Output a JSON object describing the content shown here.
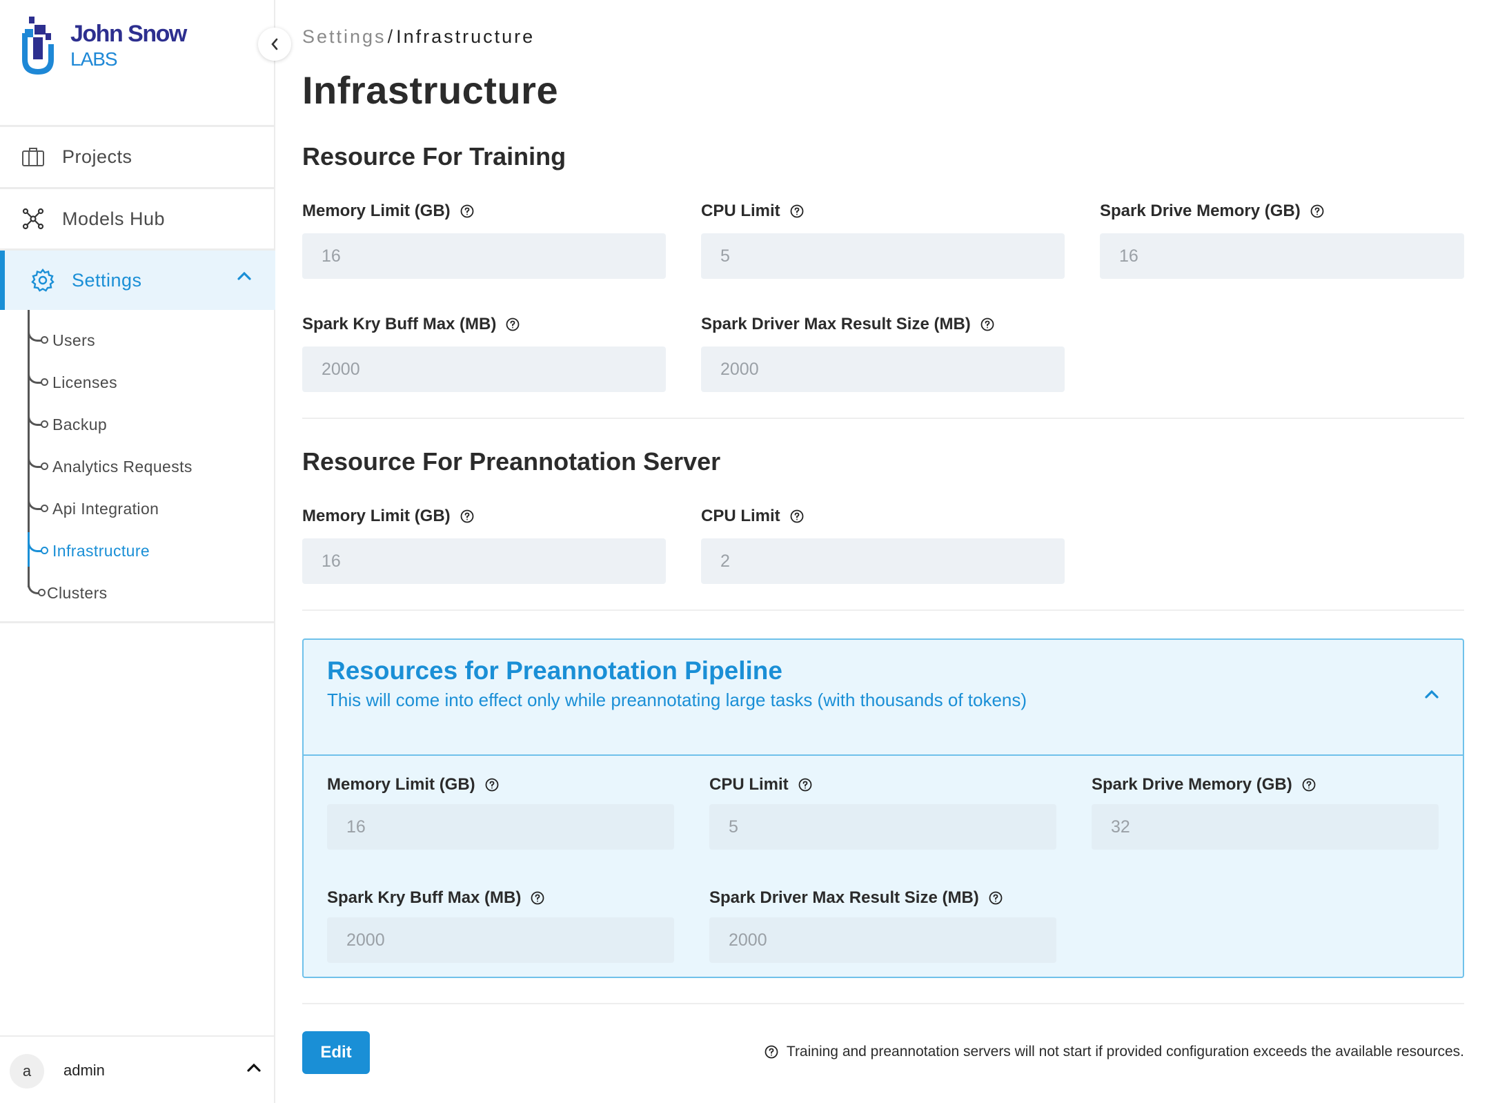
{
  "brand": {
    "line1": "John Snow",
    "line2": "LABS",
    "primary_color": "#2d2f8f",
    "accent_color": "#1a8fd6"
  },
  "sidebar": {
    "items": [
      {
        "label": "Projects",
        "icon": "briefcase-icon"
      },
      {
        "label": "Models Hub",
        "icon": "network-icon"
      },
      {
        "label": "Settings",
        "icon": "gear-icon"
      }
    ],
    "settings_children": [
      "Users",
      "Licenses",
      "Backup",
      "Analytics Requests",
      "Api Integration",
      "Infrastructure",
      "Clusters"
    ],
    "active_child": "Infrastructure"
  },
  "user": {
    "avatar_letter": "a",
    "name": "admin"
  },
  "breadcrumb": {
    "parent": "Settings",
    "separator": "/",
    "current": "Infrastructure"
  },
  "page_title": "Infrastructure",
  "training": {
    "title": "Resource For Training",
    "memory_label": "Memory Limit (GB)",
    "memory_value": "16",
    "cpu_label": "CPU Limit",
    "cpu_value": "5",
    "spark_mem_label": "Spark Drive Memory (GB)",
    "spark_mem_value": "16",
    "kry_label": "Spark Kry Buff Max (MB)",
    "kry_value": "2000",
    "driver_label": "Spark Driver Max Result Size (MB)",
    "driver_value": "2000"
  },
  "preannotation_server": {
    "title": "Resource For Preannotation Server",
    "memory_label": "Memory Limit (GB)",
    "memory_value": "16",
    "cpu_label": "CPU Limit",
    "cpu_value": "2"
  },
  "pipeline": {
    "title": "Resources for Preannotation Pipeline",
    "subtitle": "This will come into effect only while preannotating large tasks (with thousands of tokens)",
    "memory_label": "Memory Limit (GB)",
    "memory_value": "16",
    "cpu_label": "CPU Limit",
    "cpu_value": "5",
    "spark_mem_label": "Spark Drive Memory (GB)",
    "spark_mem_value": "32",
    "kry_label": "Spark Kry Buff Max (MB)",
    "kry_value": "2000",
    "driver_label": "Spark Driver Max Result Size (MB)",
    "driver_value": "2000"
  },
  "actions": {
    "edit_label": "Edit"
  },
  "footer_note": "Training and preannotation servers will not start if provided configuration exceeds the available resources."
}
